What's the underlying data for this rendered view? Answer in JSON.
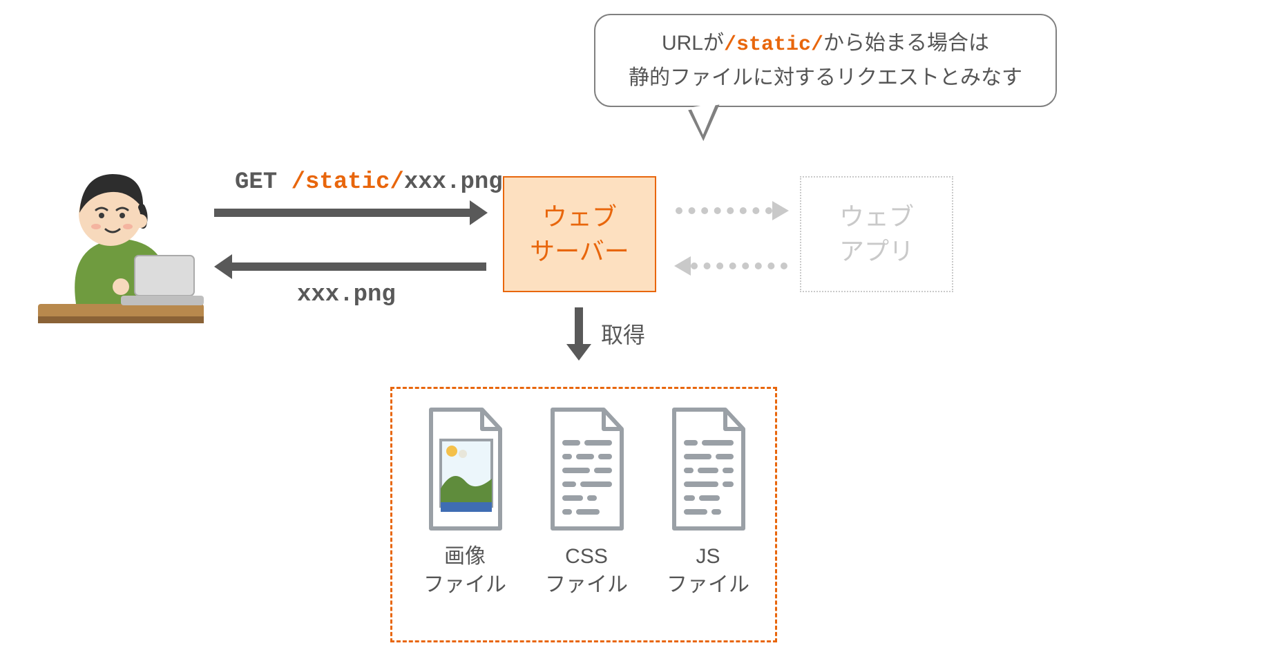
{
  "bubble": {
    "prefix": "URLが",
    "highlight": "/static/",
    "suffix": "から始まる場合は",
    "line2": "静的ファイルに対するリクエストとみなす"
  },
  "request": {
    "method": "GET ",
    "path_highlight": "/static/",
    "path_rest": "xxx.png"
  },
  "response_label": "xxx.png",
  "server_box": {
    "line1": "ウェブ",
    "line2": "サーバー"
  },
  "app_box": {
    "line1": "ウェブ",
    "line2": "アプリ"
  },
  "fetch_label": "取得",
  "files": {
    "image": {
      "line1": "画像",
      "line2": "ファイル"
    },
    "css": {
      "line1": "CSS",
      "line2": "ファイル"
    },
    "js": {
      "line1": "JS",
      "line2": "ファイル"
    }
  },
  "colors": {
    "accent": "#e8660c",
    "muted": "#c9c9c9",
    "line": "#595959"
  }
}
